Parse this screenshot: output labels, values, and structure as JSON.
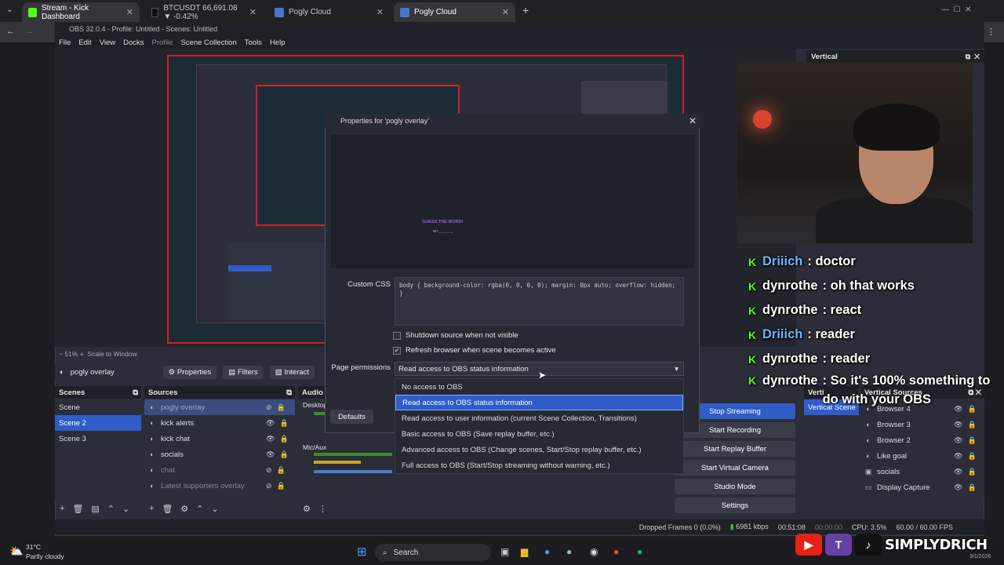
{
  "browser": {
    "tabs": [
      {
        "label": "Stream - Kick Dashboard",
        "color": "#53fc18"
      },
      {
        "label": "BTCUSDT 66,691.08 ▼ -0.42%",
        "color": "#222"
      },
      {
        "label": "Pogly Cloud",
        "color": "#4a76c9"
      },
      {
        "label": "Pogly Cloud",
        "color": "#4a76c9"
      }
    ]
  },
  "obs": {
    "title": "OBS 32.0.4 - Profile: Untitled - Scenes: Untitled",
    "menu": [
      "File",
      "Edit",
      "View",
      "Docks",
      "Profile",
      "Scene Collection",
      "Tools",
      "Help"
    ],
    "zoom": "51%",
    "scale": "Scale to Window",
    "source_bar": {
      "source": "pogly overlay",
      "properties": "Properties",
      "filters": "Filters",
      "interact": "Interact"
    },
    "vertical_title": "Vertical",
    "scenes": {
      "title": "Scenes",
      "items": [
        "Scene",
        "Scene 2",
        "Scene 3"
      ],
      "selected": 1
    },
    "sources": {
      "title": "Sources",
      "items": [
        "pogly overlay",
        "kick alerts",
        "kick chat",
        "socials",
        "chat",
        "Latest supporters overlay"
      ]
    },
    "audio": {
      "title": "Audio",
      "desktop": "Desktop",
      "mic": "Mic/Aux"
    },
    "controls": {
      "stop_streaming": "Stop Streaming",
      "start_recording": "Start Recording",
      "start_replay": "Start Replay Buffer",
      "start_virtual": "Start Virtual Camera",
      "studio_mode": "Studio Mode",
      "settings": "Settings"
    },
    "vertical_scene_head": "Verti",
    "vertical_scene": "Vertical Scene",
    "vertical_sources": {
      "title": "Vertical Sources",
      "items": [
        "Browser 4",
        "Browser 3",
        "Browser 2",
        "Like goal",
        "socials",
        "Display Capture"
      ]
    },
    "status": {
      "dropped": "Dropped Frames 0 (0.0%)",
      "kbps": "6981 kbps",
      "time": "00:51:08",
      "rec": "00:00:00",
      "cpu": "CPU: 3.5%",
      "fps": "60.00 / 60.00 FPS"
    }
  },
  "dialog": {
    "title": "Properties for 'pogly overlay'",
    "preview_text": "GUESS THE WORD!",
    "preview_sub": "W I _ _ _ _ _",
    "css_label": "Custom CSS",
    "css_value": "body { background-color: rgba(0, 0, 0, 0); margin: 0px auto; overflow: hidden; }",
    "shutdown_label": "Shutdown source when not visible",
    "refresh_label": "Refresh browser when scene becomes active",
    "perm_label": "Page permissions",
    "perm_selected": "Read access to OBS status information",
    "options": [
      "No access to OBS",
      "Read access to OBS status information",
      "Read access to user information (current Scene Collection, Transitions)",
      "Basic access to OBS (Save replay buffer, etc.)",
      "Advanced access to OBS (Change scenes, Start/Stop replay buffer, etc.)",
      "Full access to OBS (Start/Stop streaming without warning, etc.)"
    ],
    "defaults": "Defaults"
  },
  "chat": [
    {
      "user": "Driiich",
      "msg": ": doctor",
      "blue": true
    },
    {
      "user": "dynrothe",
      "msg": ": oh that works",
      "blue": false
    },
    {
      "user": "dynrothe",
      "msg": ": react",
      "blue": false
    },
    {
      "user": "Driiich",
      "msg": ": reader",
      "blue": true
    },
    {
      "user": "dynrothe",
      "msg": ": reader",
      "blue": false
    },
    {
      "user": "dynrothe",
      "msg": ": So it's 100% something to do with your OBS",
      "blue": false
    }
  ],
  "taskbar": {
    "weather_temp": "31°C",
    "weather_desc": "Partly cloudy",
    "search": "Search",
    "date": "3/1/2026"
  },
  "brand": "SIMPLYDRICH"
}
